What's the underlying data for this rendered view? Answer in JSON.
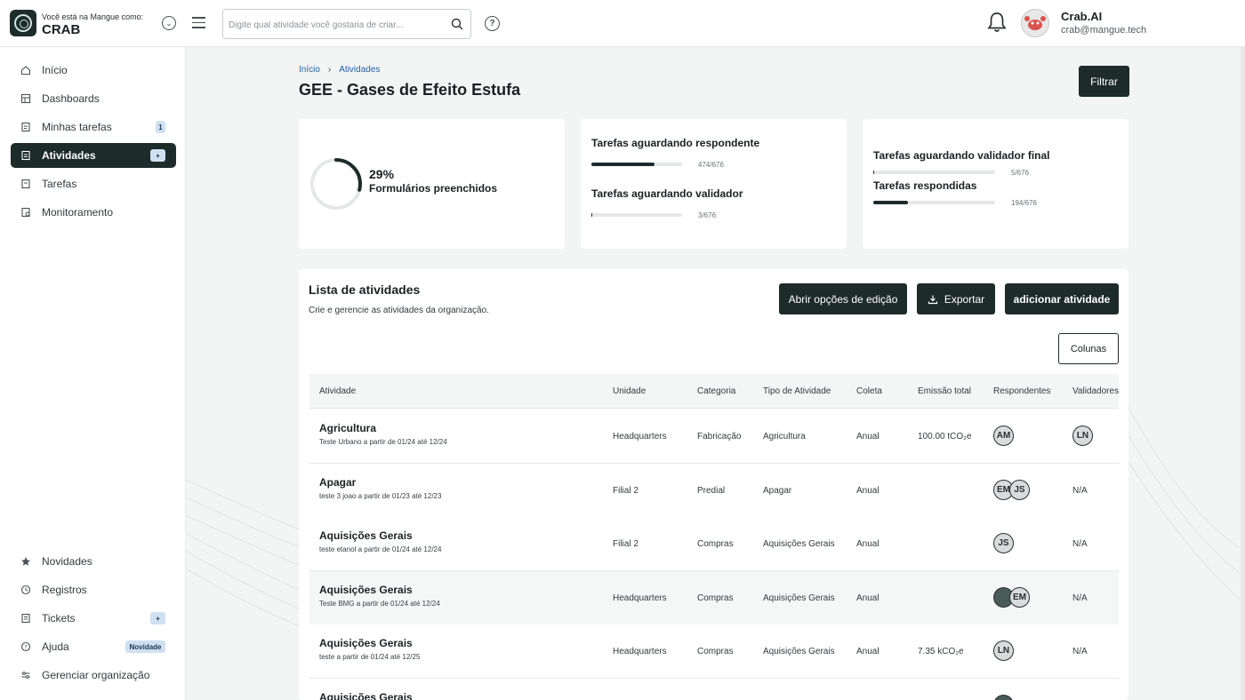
{
  "header": {
    "org_caption": "Você está na Mangue como:",
    "org_name": "CRAB",
    "search_placeholder": "Digite qual atividade você gostaria de criar...",
    "help_label": "?",
    "user_name": "Crab.AI",
    "user_email": "crab@mangue.tech"
  },
  "sidebar": {
    "items": [
      {
        "label": "Início",
        "icon": "home-icon"
      },
      {
        "label": "Dashboards",
        "icon": "dashboard-icon"
      },
      {
        "label": "Minhas tarefas",
        "icon": "task-icon",
        "badge": "1"
      },
      {
        "label": "Atividades",
        "icon": "activity-icon",
        "badge": "+"
      },
      {
        "label": "Tarefas",
        "icon": "task-icon"
      },
      {
        "label": "Monitoramento",
        "icon": "monitor-icon"
      }
    ],
    "bottom_items": [
      {
        "label": "Novidades",
        "icon": "star-icon"
      },
      {
        "label": "Registros",
        "icon": "history-icon"
      },
      {
        "label": "Tickets",
        "icon": "ticket-icon",
        "badge": "+"
      },
      {
        "label": "Ajuda",
        "icon": "help-icon",
        "badge": "Novidade"
      },
      {
        "label": "Gerenciar organização",
        "icon": "settings-sliders-icon"
      }
    ]
  },
  "breadcrumb": {
    "home": "Início",
    "separator": "›",
    "current": "Atividades"
  },
  "page_title": "GEE - Gases de Efeito Estufa",
  "filter_label": "Filtrar",
  "stats": {
    "progress": {
      "percent_label": "29%",
      "fraction": 0.29,
      "label": "Formulários preenchidos"
    },
    "awaiting_respondent": {
      "title": "Tarefas aguardando respondente",
      "count": "474/676",
      "fraction": 0.7
    },
    "awaiting_validator": {
      "title": "Tarefas aguardando validador",
      "count": "3/676",
      "fraction": 0.0044
    },
    "awaiting_final_validator": {
      "title": "Tarefas aguardando validador final",
      "count": "5/676",
      "fraction": 0.0074
    },
    "answered": {
      "title": "Tarefas respondidas",
      "count": "194/676",
      "fraction": 0.287
    }
  },
  "list": {
    "title": "Lista de atividades",
    "subtitle": "Crie e gerencie as atividades da organização.",
    "edit_options_label": "Abrir opções de edição",
    "export_label": "Exportar",
    "add_label": "adicionar atividade",
    "columns_label": "Colunas",
    "headers": [
      "Atividade",
      "Unidade",
      "Categoria",
      "Tipo de Atividade",
      "Coleta",
      "Emissão total",
      "Respondentes",
      "Validadores"
    ],
    "rows": [
      {
        "name": "Agricultura",
        "desc": "Teste Urbano a partir de 01/24 até 12/24",
        "unit": "Headquarters",
        "category": "Fabricação",
        "type": "Agricultura",
        "collection": "Anual",
        "emission": "100.00 tCO₂e",
        "respondents": [
          "AM"
        ],
        "validators": [
          "LN"
        ],
        "shade": false
      },
      {
        "name": "Apagar",
        "desc": "teste 3 joao a partir de 01/23 até 12/23",
        "unit": "Filial 2",
        "category": "Predial",
        "type": "Apagar",
        "collection": "Anual",
        "emission": "",
        "respondents": [
          "EM",
          "JS"
        ],
        "validators_text": "N/A",
        "shade": false
      },
      {
        "name": "Aquisições Gerais",
        "desc": "teste etanol a partir de 01/24 até 12/24",
        "unit": "Filial 2",
        "category": "Compras",
        "type": "Aquisições Gerais",
        "collection": "Anual",
        "emission": "",
        "respondents": [
          "JS"
        ],
        "validators_text": "N/A",
        "shade": false
      },
      {
        "name": "Aquisições Gerais",
        "desc": "Teste BMG a partir de 01/24 até 12/24",
        "unit": "Headquarters",
        "category": "Compras",
        "type": "Aquisições Gerais",
        "collection": "Anual",
        "emission": "",
        "respondents": [
          "",
          "EM"
        ],
        "validators_text": "N/A",
        "shade": true
      },
      {
        "name": "Aquisições Gerais",
        "desc": "teste a partir de 01/24 até 12/25",
        "unit": "Headquarters",
        "category": "Compras",
        "type": "Aquisições Gerais",
        "collection": "Anual",
        "emission": "7.35 kCO₂e",
        "respondents": [
          "LN"
        ],
        "validators_text": "N/A",
        "shade": false
      },
      {
        "name": "Aquisições Gerais",
        "desc": "",
        "unit": "",
        "category": "",
        "type": "",
        "collection": "",
        "emission": "",
        "respondents": [
          ""
        ],
        "validators_text": "",
        "shade": false
      }
    ]
  },
  "colors": {
    "primary": "#1d2b2a",
    "badge": "#cfe0f1",
    "link": "#1f5fa8"
  }
}
